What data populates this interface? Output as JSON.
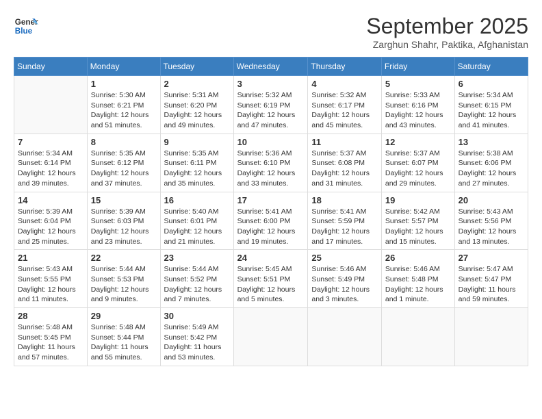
{
  "header": {
    "logo_line1": "General",
    "logo_line2": "Blue",
    "month": "September 2025",
    "location": "Zarghun Shahr, Paktika, Afghanistan"
  },
  "weekdays": [
    "Sunday",
    "Monday",
    "Tuesday",
    "Wednesday",
    "Thursday",
    "Friday",
    "Saturday"
  ],
  "weeks": [
    [
      {
        "day": "",
        "sunrise": "",
        "sunset": "",
        "daylight": ""
      },
      {
        "day": "1",
        "sunrise": "Sunrise: 5:30 AM",
        "sunset": "Sunset: 6:21 PM",
        "daylight": "Daylight: 12 hours and 51 minutes."
      },
      {
        "day": "2",
        "sunrise": "Sunrise: 5:31 AM",
        "sunset": "Sunset: 6:20 PM",
        "daylight": "Daylight: 12 hours and 49 minutes."
      },
      {
        "day": "3",
        "sunrise": "Sunrise: 5:32 AM",
        "sunset": "Sunset: 6:19 PM",
        "daylight": "Daylight: 12 hours and 47 minutes."
      },
      {
        "day": "4",
        "sunrise": "Sunrise: 5:32 AM",
        "sunset": "Sunset: 6:17 PM",
        "daylight": "Daylight: 12 hours and 45 minutes."
      },
      {
        "day": "5",
        "sunrise": "Sunrise: 5:33 AM",
        "sunset": "Sunset: 6:16 PM",
        "daylight": "Daylight: 12 hours and 43 minutes."
      },
      {
        "day": "6",
        "sunrise": "Sunrise: 5:34 AM",
        "sunset": "Sunset: 6:15 PM",
        "daylight": "Daylight: 12 hours and 41 minutes."
      }
    ],
    [
      {
        "day": "7",
        "sunrise": "Sunrise: 5:34 AM",
        "sunset": "Sunset: 6:14 PM",
        "daylight": "Daylight: 12 hours and 39 minutes."
      },
      {
        "day": "8",
        "sunrise": "Sunrise: 5:35 AM",
        "sunset": "Sunset: 6:12 PM",
        "daylight": "Daylight: 12 hours and 37 minutes."
      },
      {
        "day": "9",
        "sunrise": "Sunrise: 5:35 AM",
        "sunset": "Sunset: 6:11 PM",
        "daylight": "Daylight: 12 hours and 35 minutes."
      },
      {
        "day": "10",
        "sunrise": "Sunrise: 5:36 AM",
        "sunset": "Sunset: 6:10 PM",
        "daylight": "Daylight: 12 hours and 33 minutes."
      },
      {
        "day": "11",
        "sunrise": "Sunrise: 5:37 AM",
        "sunset": "Sunset: 6:08 PM",
        "daylight": "Daylight: 12 hours and 31 minutes."
      },
      {
        "day": "12",
        "sunrise": "Sunrise: 5:37 AM",
        "sunset": "Sunset: 6:07 PM",
        "daylight": "Daylight: 12 hours and 29 minutes."
      },
      {
        "day": "13",
        "sunrise": "Sunrise: 5:38 AM",
        "sunset": "Sunset: 6:06 PM",
        "daylight": "Daylight: 12 hours and 27 minutes."
      }
    ],
    [
      {
        "day": "14",
        "sunrise": "Sunrise: 5:39 AM",
        "sunset": "Sunset: 6:04 PM",
        "daylight": "Daylight: 12 hours and 25 minutes."
      },
      {
        "day": "15",
        "sunrise": "Sunrise: 5:39 AM",
        "sunset": "Sunset: 6:03 PM",
        "daylight": "Daylight: 12 hours and 23 minutes."
      },
      {
        "day": "16",
        "sunrise": "Sunrise: 5:40 AM",
        "sunset": "Sunset: 6:01 PM",
        "daylight": "Daylight: 12 hours and 21 minutes."
      },
      {
        "day": "17",
        "sunrise": "Sunrise: 5:41 AM",
        "sunset": "Sunset: 6:00 PM",
        "daylight": "Daylight: 12 hours and 19 minutes."
      },
      {
        "day": "18",
        "sunrise": "Sunrise: 5:41 AM",
        "sunset": "Sunset: 5:59 PM",
        "daylight": "Daylight: 12 hours and 17 minutes."
      },
      {
        "day": "19",
        "sunrise": "Sunrise: 5:42 AM",
        "sunset": "Sunset: 5:57 PM",
        "daylight": "Daylight: 12 hours and 15 minutes."
      },
      {
        "day": "20",
        "sunrise": "Sunrise: 5:43 AM",
        "sunset": "Sunset: 5:56 PM",
        "daylight": "Daylight: 12 hours and 13 minutes."
      }
    ],
    [
      {
        "day": "21",
        "sunrise": "Sunrise: 5:43 AM",
        "sunset": "Sunset: 5:55 PM",
        "daylight": "Daylight: 12 hours and 11 minutes."
      },
      {
        "day": "22",
        "sunrise": "Sunrise: 5:44 AM",
        "sunset": "Sunset: 5:53 PM",
        "daylight": "Daylight: 12 hours and 9 minutes."
      },
      {
        "day": "23",
        "sunrise": "Sunrise: 5:44 AM",
        "sunset": "Sunset: 5:52 PM",
        "daylight": "Daylight: 12 hours and 7 minutes."
      },
      {
        "day": "24",
        "sunrise": "Sunrise: 5:45 AM",
        "sunset": "Sunset: 5:51 PM",
        "daylight": "Daylight: 12 hours and 5 minutes."
      },
      {
        "day": "25",
        "sunrise": "Sunrise: 5:46 AM",
        "sunset": "Sunset: 5:49 PM",
        "daylight": "Daylight: 12 hours and 3 minutes."
      },
      {
        "day": "26",
        "sunrise": "Sunrise: 5:46 AM",
        "sunset": "Sunset: 5:48 PM",
        "daylight": "Daylight: 12 hours and 1 minute."
      },
      {
        "day": "27",
        "sunrise": "Sunrise: 5:47 AM",
        "sunset": "Sunset: 5:47 PM",
        "daylight": "Daylight: 11 hours and 59 minutes."
      }
    ],
    [
      {
        "day": "28",
        "sunrise": "Sunrise: 5:48 AM",
        "sunset": "Sunset: 5:45 PM",
        "daylight": "Daylight: 11 hours and 57 minutes."
      },
      {
        "day": "29",
        "sunrise": "Sunrise: 5:48 AM",
        "sunset": "Sunset: 5:44 PM",
        "daylight": "Daylight: 11 hours and 55 minutes."
      },
      {
        "day": "30",
        "sunrise": "Sunrise: 5:49 AM",
        "sunset": "Sunset: 5:42 PM",
        "daylight": "Daylight: 11 hours and 53 minutes."
      },
      {
        "day": "",
        "sunrise": "",
        "sunset": "",
        "daylight": ""
      },
      {
        "day": "",
        "sunrise": "",
        "sunset": "",
        "daylight": ""
      },
      {
        "day": "",
        "sunrise": "",
        "sunset": "",
        "daylight": ""
      },
      {
        "day": "",
        "sunrise": "",
        "sunset": "",
        "daylight": ""
      }
    ]
  ]
}
